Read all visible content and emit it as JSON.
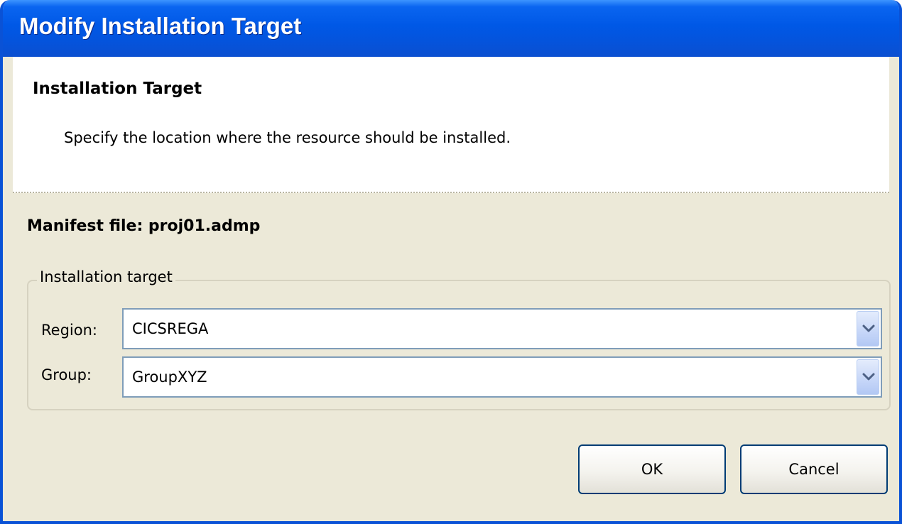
{
  "window": {
    "title": "Modify Installation Target"
  },
  "header": {
    "title": "Installation Target",
    "description": "Specify the location where the resource should be installed."
  },
  "manifest": {
    "text": "Manifest file: proj01.admp"
  },
  "installation_target": {
    "legend": "Installation target",
    "region": {
      "label": "Region:",
      "value": "CICSREGA"
    },
    "group": {
      "label": "Group:",
      "value": "GroupXYZ"
    }
  },
  "buttons": {
    "ok_label": "OK",
    "cancel_label": "Cancel"
  },
  "colors": {
    "titlebar": "#0058e6",
    "window_border": "#0a52d6",
    "dialog_background": "#ece9d8",
    "header_background": "#ffffff",
    "combo_border": "#7f9db9",
    "button_border": "#003c74"
  },
  "icons": {
    "dropdown": "chevron-down-icon"
  }
}
